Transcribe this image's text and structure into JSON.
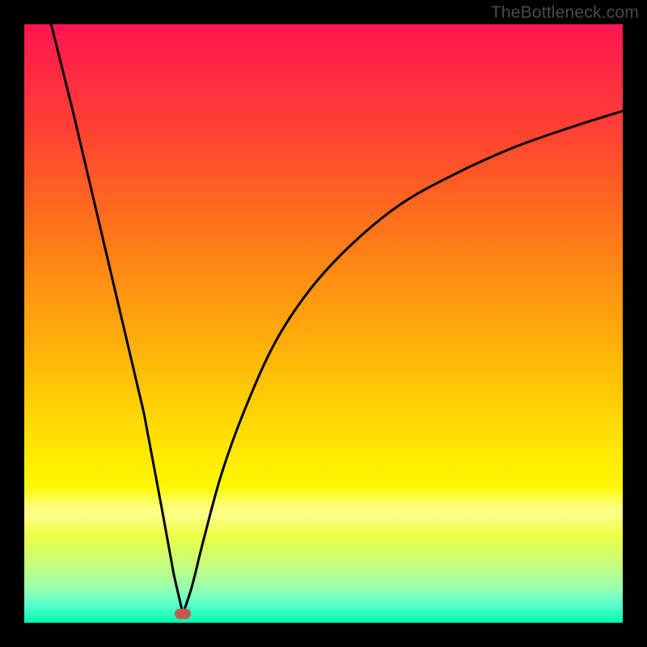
{
  "watermark": "TheBottleneck.com",
  "colors": {
    "frame_background": "#000000",
    "curve_stroke": "#000000",
    "marker_fill": "#c15a4f",
    "gradient_top": "#ff1450",
    "gradient_bottom": "#00ffb0"
  },
  "chart_data": {
    "type": "line",
    "title": "",
    "xlabel": "",
    "ylabel": "",
    "xlim": [
      0,
      100
    ],
    "ylim": [
      0,
      100
    ],
    "grid": false,
    "description": "Black V-shaped curve over a vertical red-to-green gradient. Left branch is a steep near-straight line from the top-left down to the minimum; right branch rises and flattens asymptotically toward the upper-right. A small rounded marker sits at the curve minimum near the bottom.",
    "series": [
      {
        "name": "left-branch",
        "x": [
          4.5,
          8,
          12,
          16,
          20,
          23,
          25,
          26.5
        ],
        "y": [
          100,
          86,
          69,
          52,
          35,
          19,
          8,
          1.5
        ]
      },
      {
        "name": "right-branch",
        "x": [
          26.5,
          28,
          30,
          33,
          37,
          42,
          48,
          55,
          63,
          72,
          82,
          92,
          100
        ],
        "y": [
          1.5,
          6,
          14,
          25,
          36,
          47,
          56,
          63.5,
          70,
          75,
          79.5,
          83,
          85.5
        ]
      }
    ],
    "minimum_point": {
      "x": 26.5,
      "y": 1.5
    },
    "background_gradient_axis": "vertical"
  }
}
